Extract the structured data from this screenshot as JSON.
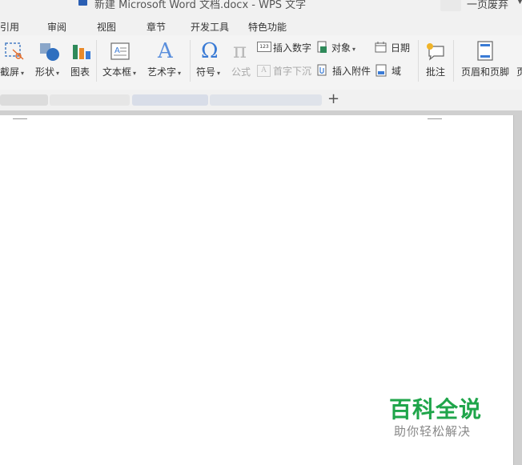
{
  "titlebar": {
    "document_title": "新建 Microsoft Word 文档.docx - WPS 文字",
    "user_name": "一页废弃"
  },
  "menu": {
    "tabs": [
      "引用",
      "审阅",
      "视图",
      "章节",
      "开发工具",
      "特色功能"
    ]
  },
  "ribbon": {
    "screenshot": "截屏",
    "shapes": "形状",
    "chart": "图表",
    "textbox": "文本框",
    "wordart": "艺术字",
    "symbol": "符号",
    "formula": "公式",
    "insert_number": "插入数字",
    "object": "对象",
    "date": "日期",
    "drop_cap": "首字下沉",
    "insert_attachment": "插入附件",
    "field": "域",
    "comment": "批注",
    "header_footer": "页眉和页脚",
    "cut_off_label": "页",
    "insert_number_icon_text": "123"
  },
  "tabstrip": {
    "new_tab_label": "+"
  },
  "watermark": {
    "main": "百科全说",
    "sub": "助你轻松解决"
  },
  "colors": {
    "watermark_green": "#1fa54a",
    "icon_blue": "#3a7bd5",
    "icon_orange": "#e98a2a"
  }
}
